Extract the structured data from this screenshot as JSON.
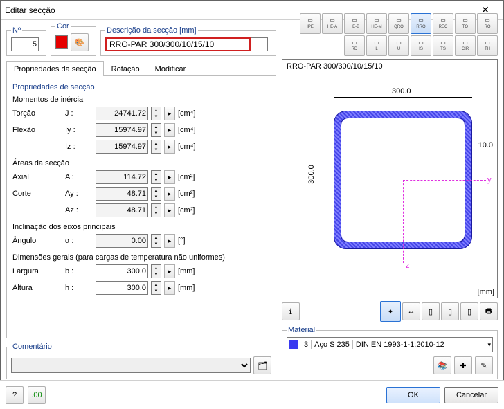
{
  "window": {
    "title": "Editar secção",
    "close": "✕"
  },
  "header": {
    "no_legend": "Nº",
    "no_value": "5",
    "cor_legend": "Cor",
    "desc_legend": "Descrição da secção [mm]",
    "desc_value": "RRO-PAR 300/300/10/15/10"
  },
  "palette": [
    "IPE",
    "HE-A",
    "HE-B",
    "HE-M",
    "QRO",
    "RRO",
    "REC",
    "TO",
    "RO",
    "RD",
    "L",
    "U",
    "IS",
    "TS",
    "CIR",
    "TH"
  ],
  "palette_selected": 5,
  "tabs": {
    "props": "Propriedades da secção",
    "rot": "Rotação",
    "mod": "Modificar"
  },
  "props": {
    "title": "Propriedades de secção",
    "moments_title": "Momentos de inércia",
    "torsion": "Torção",
    "j_sym": "J :",
    "j_val": "24741.72",
    "j_unit": "[cm⁴]",
    "flexao": "Flexão",
    "iy_sym": "Iy :",
    "iy_val": "15974.97",
    "iy_unit": "[cm⁴]",
    "iz_sym": "Iz :",
    "iz_val": "15974.97",
    "iz_unit": "[cm⁴]",
    "areas_title": "Áreas da secção",
    "axial": "Axial",
    "a_sym": "A :",
    "a_val": "114.72",
    "a_unit": "[cm²]",
    "corte": "Corte",
    "ay_sym": "Ay :",
    "ay_val": "48.71",
    "ay_unit": "[cm²]",
    "az_sym": "Az :",
    "az_val": "48.71",
    "az_unit": "[cm²]",
    "incl_title": "Inclinação dos eixos principais",
    "angulo": "Ângulo",
    "alpha_sym": "α :",
    "alpha_val": "0.00",
    "alpha_unit": "[°]",
    "dim_title": "Dimensões gerais (para cargas de temperatura não uniformes)",
    "larg": "Largura",
    "b_sym": "b :",
    "b_val": "300.0",
    "b_unit": "[mm]",
    "alt": "Altura",
    "h_sym": "h :",
    "h_val": "300.0",
    "h_unit": "[mm]"
  },
  "comment_legend": "Comentário",
  "preview": {
    "title": "RRO-PAR 300/300/10/15/10",
    "w": "300.0",
    "h": "300.0",
    "t": "10.0",
    "mm": "[mm]",
    "y": "y",
    "z": "z"
  },
  "material": {
    "legend": "Material",
    "idx": "3",
    "name": "Aço S 235",
    "norm": "DIN EN 1993-1-1:2010-12"
  },
  "footer": {
    "ok": "OK",
    "cancel": "Cancelar"
  }
}
